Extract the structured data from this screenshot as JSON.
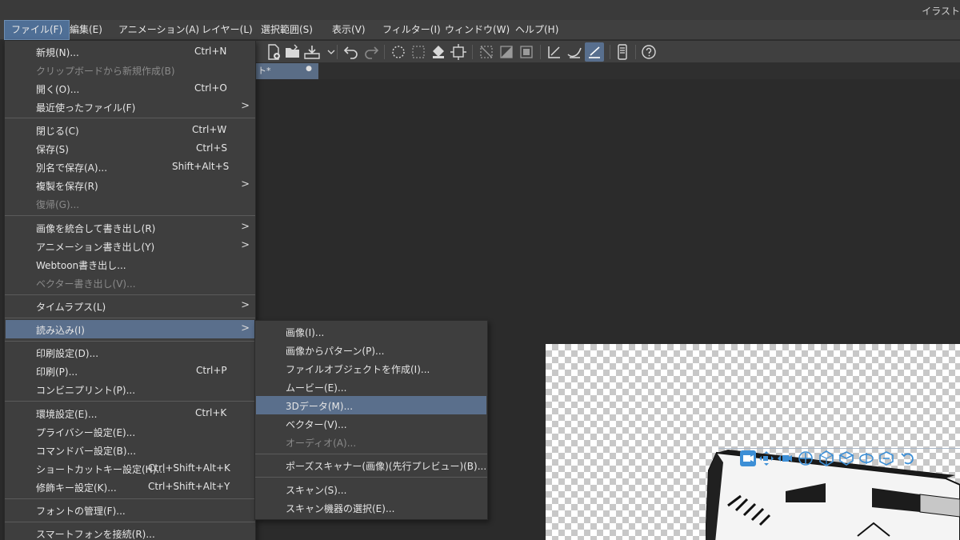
{
  "window": {
    "title": "イラスト"
  },
  "menubar": [
    {
      "id": "file",
      "label": "ファイル(F)",
      "active": true
    },
    {
      "id": "edit",
      "label": "編集(E)"
    },
    {
      "id": "animation",
      "label": "アニメーション(A)"
    },
    {
      "id": "layer",
      "label": "レイヤー(L)"
    },
    {
      "id": "selection",
      "label": "選択範囲(S)"
    },
    {
      "id": "view",
      "label": "表示(V)"
    },
    {
      "id": "filter",
      "label": "フィルター(I)"
    },
    {
      "id": "window",
      "label": "ウィンドウ(W)"
    },
    {
      "id": "help",
      "label": "ヘルプ(H)"
    }
  ],
  "toolbar_icons": [
    "new-icon",
    "open-icon",
    "save-icon",
    "undo-icon",
    "redo-icon",
    "clear-icon",
    "fill-icon",
    "transform-icon",
    "deselect-icon",
    "invert-selection-icon",
    "show-selection-icon",
    "snap-ruler-icon",
    "snap-icon",
    "snap-grid-icon",
    "smartphone-icon",
    "help-icon"
  ],
  "document_tab": {
    "label": "ト*",
    "modified_marker": "●"
  },
  "file_menu": {
    "items": [
      {
        "label": "新規(N)...",
        "shortcut": "Ctrl+N",
        "enabled": true
      },
      {
        "label": "クリップボードから新規作成(B)",
        "shortcut": "",
        "enabled": false
      },
      {
        "label": "開く(O)...",
        "shortcut": "Ctrl+O",
        "enabled": true
      },
      {
        "label": "最近使ったファイル(F)",
        "shortcut": "",
        "enabled": true,
        "submenu": true
      },
      {
        "label": "閉じる(C)",
        "shortcut": "Ctrl+W",
        "enabled": true
      },
      {
        "label": "保存(S)",
        "shortcut": "Ctrl+S",
        "enabled": true
      },
      {
        "label": "別名で保存(A)...",
        "shortcut": "Shift+Alt+S",
        "enabled": true
      },
      {
        "label": "複製を保存(R)",
        "shortcut": "",
        "enabled": true,
        "submenu": true
      },
      {
        "label": "復帰(G)...",
        "shortcut": "",
        "enabled": false
      },
      {
        "label": "画像を統合して書き出し(R)",
        "shortcut": "",
        "enabled": true,
        "submenu": true
      },
      {
        "label": "アニメーション書き出し(Y)",
        "shortcut": "",
        "enabled": true,
        "submenu": true
      },
      {
        "label": "Webtoon書き出し...",
        "shortcut": "",
        "enabled": true
      },
      {
        "label": "ベクター書き出し(V)...",
        "shortcut": "",
        "enabled": false
      },
      {
        "label": "タイムラプス(L)",
        "shortcut": "",
        "enabled": true,
        "submenu": true
      },
      {
        "label": "読み込み(I)",
        "shortcut": "",
        "enabled": true,
        "submenu": true,
        "highlighted": true
      },
      {
        "label": "印刷設定(D)...",
        "shortcut": "",
        "enabled": true
      },
      {
        "label": "印刷(P)...",
        "shortcut": "Ctrl+P",
        "enabled": true
      },
      {
        "label": "コンビニプリント(P)...",
        "shortcut": "",
        "enabled": true
      },
      {
        "label": "環境設定(E)...",
        "shortcut": "Ctrl+K",
        "enabled": true
      },
      {
        "label": "プライバシー設定(E)...",
        "shortcut": "",
        "enabled": true
      },
      {
        "label": "コマンドバー設定(B)...",
        "shortcut": "",
        "enabled": true
      },
      {
        "label": "ショートカットキー設定(H)...",
        "shortcut": "Ctrl+Shift+Alt+K",
        "enabled": true
      },
      {
        "label": "修飾キー設定(K)...",
        "shortcut": "Ctrl+Shift+Alt+Y",
        "enabled": true
      },
      {
        "label": "フォントの管理(F)...",
        "shortcut": "",
        "enabled": true
      },
      {
        "label": "スマートフォンを接続(R)...",
        "shortcut": "",
        "enabled": true
      }
    ]
  },
  "import_submenu": {
    "items": [
      {
        "label": "画像(I)...",
        "enabled": true
      },
      {
        "label": "画像からパターン(P)...",
        "enabled": true
      },
      {
        "label": "ファイルオブジェクトを作成(I)...",
        "enabled": true
      },
      {
        "label": "ムービー(E)...",
        "enabled": true
      },
      {
        "label": "3Dデータ(M)...",
        "enabled": true,
        "highlighted": true
      },
      {
        "label": "ベクター(V)...",
        "enabled": true
      },
      {
        "label": "オーディオ(A)...",
        "enabled": false
      },
      {
        "label": "ポーズスキャナー(画像)(先行プレビュー)(B)...",
        "enabled": true
      },
      {
        "label": "スキャン(S)...",
        "enabled": true
      },
      {
        "label": "スキャン機器の選択(E)...",
        "enabled": true
      }
    ]
  },
  "object_toolbar_icons": [
    "camera-rotate-icon",
    "camera-pan-icon",
    "camera-dolly-icon",
    "move-icon",
    "rotate-icon",
    "rotate-x-icon",
    "rotate-y-icon",
    "rotate-z-icon",
    "reset-icon"
  ],
  "colors": {
    "accent": "#5a6f8c",
    "menu_bg": "#3e3e3e",
    "disabled_text": "#8a8a8a",
    "object_tool": "#3d8fd6"
  }
}
